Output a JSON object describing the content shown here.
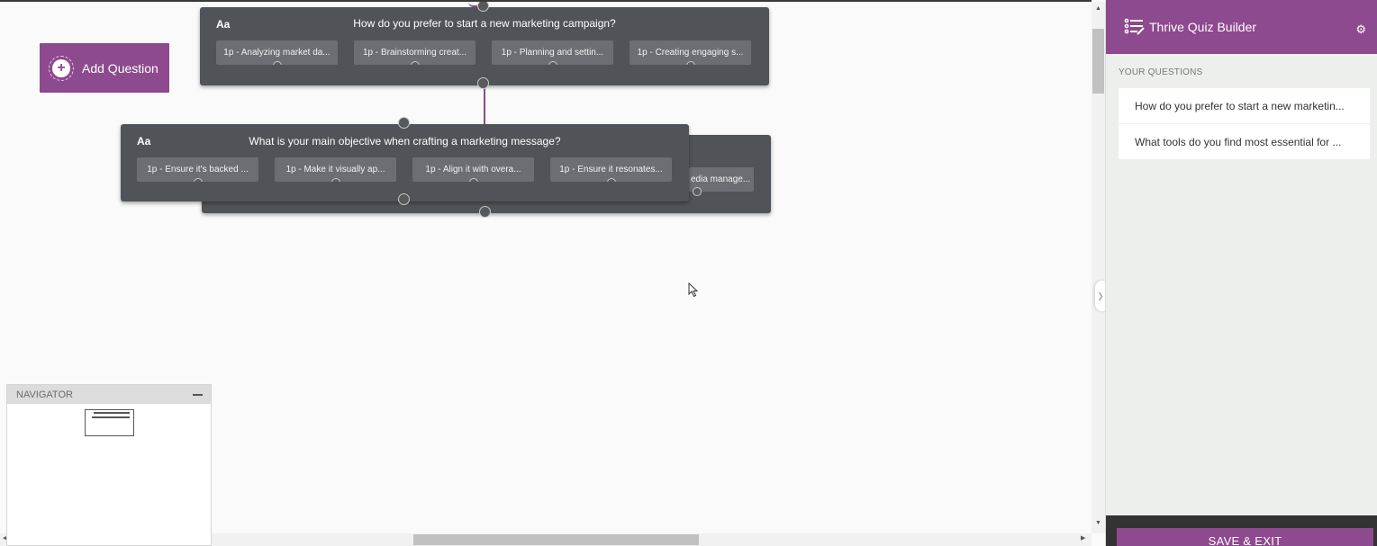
{
  "canvas": {
    "add_question_label": "Add Question",
    "questions": [
      {
        "type_icon": "Aa",
        "title": "How do you prefer to start a new marketing campaign?",
        "answers": [
          "1p - Analyzing market da...",
          "1p - Brainstorming creat...",
          "1p - Planning and settin...",
          "1p - Creating engaging s..."
        ]
      },
      {
        "type_icon": "Aa",
        "title": "What is your main objective when crafting a marketing message?",
        "answers": [
          "1p - Ensure it's backed ...",
          "1p - Make it visually ap...",
          "1p - Align it with overa...",
          "1p - Ensure it resonates..."
        ]
      },
      {
        "answers": [
          "edia manage..."
        ]
      }
    ]
  },
  "navigator": {
    "title": "NAVIGATOR"
  },
  "sidebar": {
    "title": "Thrive Quiz Builder",
    "section_label": "YOUR QUESTIONS",
    "questions": [
      "How do you prefer to start a new marketin...",
      "What tools do you find most essential for ..."
    ],
    "save_label": "SAVE & EXIT"
  },
  "colors": {
    "brand_purple": "#8e4a8e",
    "card_gray": "#505357",
    "answer_gray": "#6b6e72"
  },
  "icons": {
    "add": "plus-circle-icon",
    "settings": "gear-icon",
    "logo": "quiz-list-icon",
    "collapse": "chevron-right-icon"
  }
}
